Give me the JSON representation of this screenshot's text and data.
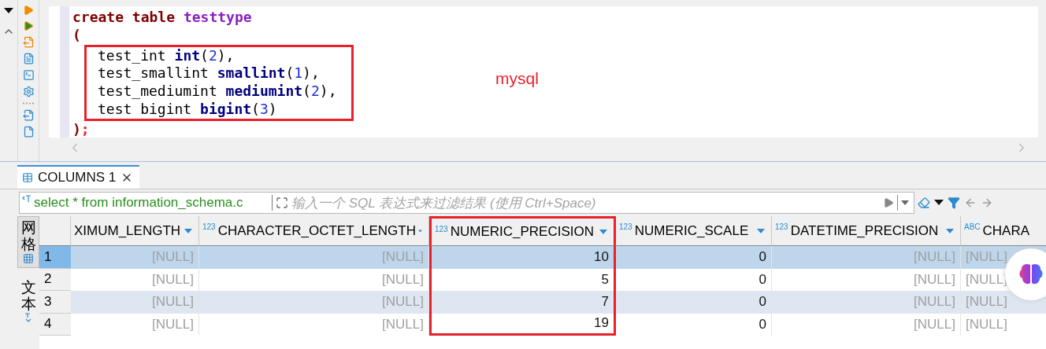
{
  "editor": {
    "lines": [
      {
        "boxed": false,
        "indented": false,
        "tokens": [
          {
            "kind": "keyword",
            "text": "create table "
          },
          {
            "kind": "name",
            "text": "testtype"
          }
        ]
      },
      {
        "boxed": false,
        "indented": false,
        "tokens": [
          {
            "kind": "keyword",
            "text": "("
          }
        ]
      },
      {
        "boxed": true,
        "indented": true,
        "tokens": [
          {
            "kind": "plain",
            "text": "test_int "
          },
          {
            "kind": "type",
            "text": "int"
          },
          {
            "kind": "plain",
            "text": "("
          },
          {
            "kind": "number",
            "text": "2"
          },
          {
            "kind": "plain",
            "text": "),"
          }
        ]
      },
      {
        "boxed": true,
        "indented": true,
        "tokens": [
          {
            "kind": "plain",
            "text": "test_smallint "
          },
          {
            "kind": "type",
            "text": "smallint"
          },
          {
            "kind": "plain",
            "text": "("
          },
          {
            "kind": "number",
            "text": "1"
          },
          {
            "kind": "plain",
            "text": "),"
          }
        ]
      },
      {
        "boxed": true,
        "indented": true,
        "tokens": [
          {
            "kind": "plain",
            "text": "test_mediumint "
          },
          {
            "kind": "type",
            "text": "mediumint"
          },
          {
            "kind": "plain",
            "text": "("
          },
          {
            "kind": "number",
            "text": "2"
          },
          {
            "kind": "plain",
            "text": "),"
          }
        ]
      },
      {
        "boxed": true,
        "indented": true,
        "tokens": [
          {
            "kind": "plain",
            "text": "test bigint "
          },
          {
            "kind": "type",
            "text": "bigint"
          },
          {
            "kind": "plain",
            "text": "("
          },
          {
            "kind": "number",
            "text": "3"
          },
          {
            "kind": "plain",
            "text": ")"
          }
        ]
      },
      {
        "boxed": false,
        "indented": false,
        "tokens": [
          {
            "kind": "keyword",
            "text": ")"
          },
          {
            "kind": "error",
            "text": ";"
          }
        ]
      }
    ],
    "note": "mysql"
  },
  "result_tab": {
    "label": "COLUMNS 1",
    "selected": true
  },
  "filter": {
    "query": "select * from information_schema.c",
    "placeholder": "输入一个 SQL 表达式来过滤结果 (使用 Ctrl+Space)"
  },
  "view_tabs": [
    {
      "label": "网格",
      "selected": true
    },
    {
      "label": "文本",
      "selected": false
    }
  ],
  "table": {
    "columns": [
      {
        "name": "XIMUM_LENGTH",
        "highlighted": false
      },
      {
        "name": "CHARACTER_OCTET_LENGTH",
        "badge": "123",
        "highlighted": false
      },
      {
        "name": "NUMERIC_PRECISION",
        "badge": "123",
        "highlighted": true
      },
      {
        "name": "NUMERIC_SCALE",
        "badge": "123",
        "highlighted": false
      },
      {
        "name": "DATETIME_PRECISION",
        "badge": "123",
        "highlighted": false
      },
      {
        "name": "CHARA",
        "badge": "ABC",
        "highlighted": false
      }
    ],
    "rows": [
      {
        "number": "1",
        "selected": true,
        "cells": [
          {
            "text": "[NULL]",
            "null": true
          },
          {
            "text": "[NULL]",
            "null": true
          },
          {
            "text": "10",
            "null": false
          },
          {
            "text": "0",
            "null": false
          },
          {
            "text": "[NULL]",
            "null": true
          },
          {
            "text": "[NULL]",
            "null": true
          }
        ]
      },
      {
        "number": "2",
        "selected": false,
        "cells": [
          {
            "text": "[NULL]",
            "null": true
          },
          {
            "text": "[NULL]",
            "null": true
          },
          {
            "text": "5",
            "null": false
          },
          {
            "text": "0",
            "null": false
          },
          {
            "text": "[NULL]",
            "null": true
          },
          {
            "text": "[NULL]",
            "null": true
          }
        ]
      },
      {
        "number": "3",
        "selected": false,
        "cells": [
          {
            "text": "[NULL]",
            "null": true
          },
          {
            "text": "[NULL]",
            "null": true
          },
          {
            "text": "7",
            "null": false
          },
          {
            "text": "0",
            "null": false
          },
          {
            "text": "[NULL]",
            "null": true
          },
          {
            "text": "[NULL]",
            "null": true
          }
        ]
      },
      {
        "number": "4",
        "selected": false,
        "cells": [
          {
            "text": "[NULL]",
            "null": true
          },
          {
            "text": "[NULL]",
            "null": true
          },
          {
            "text": "19",
            "null": false
          },
          {
            "text": "0",
            "null": false
          },
          {
            "text": "[NULL]",
            "null": true
          },
          {
            "text": "[NULL]",
            "null": true
          }
        ]
      }
    ]
  }
}
